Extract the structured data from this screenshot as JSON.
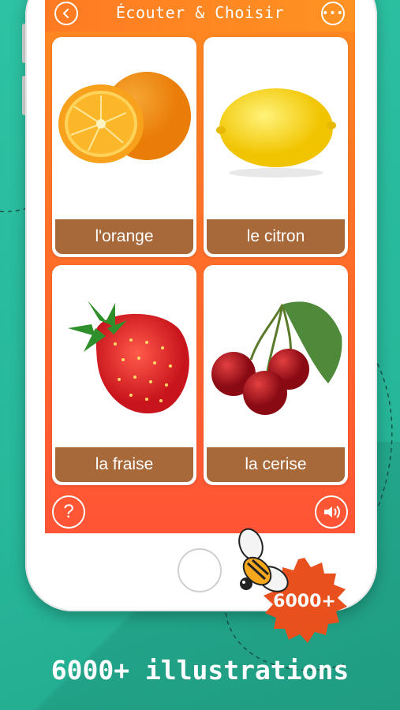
{
  "header": {
    "title": "Écouter & Choisir"
  },
  "cards": [
    {
      "label": "l'orange",
      "image": "orange-image"
    },
    {
      "label": "le citron",
      "image": "lemon-image"
    },
    {
      "label": "la fraise",
      "image": "strawberry-image"
    },
    {
      "label": "la cerise",
      "image": "cherry-image"
    }
  ],
  "footer": {
    "help_symbol": "?"
  },
  "badge": {
    "text": "6000+"
  },
  "caption": {
    "text": "6000+ illustrations"
  },
  "colors": {
    "background": "#2bbf9f",
    "screen_orange": "#ff7a22",
    "label_brown": "#a8693a",
    "badge_orange": "#e8501e"
  }
}
